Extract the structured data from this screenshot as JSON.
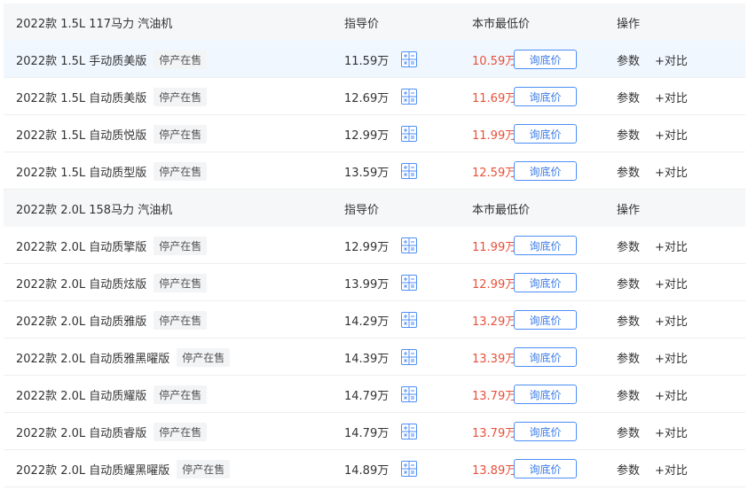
{
  "sections": [
    {
      "header": {
        "engine": "2022款 1.5L 117马力 汽油机",
        "guide_price": "指导价",
        "lowest_price": "本市最低价",
        "operation": "操作"
      },
      "rows": [
        {
          "name": "2022款 1.5L 手动质美版",
          "status": "停产在售",
          "guide_price": "11.59万",
          "lowest_price": "10.59万",
          "ask_btn": "询底价",
          "params": "参数",
          "compare": "+对比"
        },
        {
          "name": "2022款 1.5L 自动质美版",
          "status": "停产在售",
          "guide_price": "12.69万",
          "lowest_price": "11.69万",
          "ask_btn": "询底价",
          "params": "参数",
          "compare": "+对比"
        },
        {
          "name": "2022款 1.5L 自动质悦版",
          "status": "停产在售",
          "guide_price": "12.99万",
          "lowest_price": "11.99万",
          "ask_btn": "询底价",
          "params": "参数",
          "compare": "+对比"
        },
        {
          "name": "2022款 1.5L 自动质型版",
          "status": "停产在售",
          "guide_price": "13.59万",
          "lowest_price": "12.59万",
          "ask_btn": "询底价",
          "params": "参数",
          "compare": "+对比"
        }
      ]
    },
    {
      "header": {
        "engine": "2022款 2.0L 158马力 汽油机",
        "guide_price": "指导价",
        "lowest_price": "本市最低价",
        "operation": "操作"
      },
      "rows": [
        {
          "name": "2022款 2.0L 自动质擎版",
          "status": "停产在售",
          "guide_price": "12.99万",
          "lowest_price": "11.99万",
          "ask_btn": "询底价",
          "params": "参数",
          "compare": "+对比"
        },
        {
          "name": "2022款 2.0L 自动质炫版",
          "status": "停产在售",
          "guide_price": "13.99万",
          "lowest_price": "12.99万",
          "ask_btn": "询底价",
          "params": "参数",
          "compare": "+对比"
        },
        {
          "name": "2022款 2.0L 自动质雅版",
          "status": "停产在售",
          "guide_price": "14.29万",
          "lowest_price": "13.29万",
          "ask_btn": "询底价",
          "params": "参数",
          "compare": "+对比"
        },
        {
          "name": "2022款 2.0L 自动质雅黑曜版",
          "status": "停产在售",
          "guide_price": "14.39万",
          "lowest_price": "13.39万",
          "ask_btn": "询底价",
          "params": "参数",
          "compare": "+对比"
        },
        {
          "name": "2022款 2.0L 自动质耀版",
          "status": "停产在售",
          "guide_price": "14.79万",
          "lowest_price": "13.79万",
          "ask_btn": "询底价",
          "params": "参数",
          "compare": "+对比"
        },
        {
          "name": "2022款 2.0L 自动质睿版",
          "status": "停产在售",
          "guide_price": "14.79万",
          "lowest_price": "13.79万",
          "ask_btn": "询底价",
          "params": "参数",
          "compare": "+对比"
        },
        {
          "name": "2022款 2.0L 自动质耀黑曜版",
          "status": "停产在售",
          "guide_price": "14.89万",
          "lowest_price": "13.89万",
          "ask_btn": "询底价",
          "params": "参数",
          "compare": "+对比"
        }
      ]
    }
  ],
  "icons": {
    "calculator": "calculator-icon"
  },
  "colors": {
    "lowest_price": "#e8503a",
    "button_border": "#4e8ef7",
    "header_bg": "#f6f7f9",
    "hover_bg": "#f0f7ff"
  }
}
